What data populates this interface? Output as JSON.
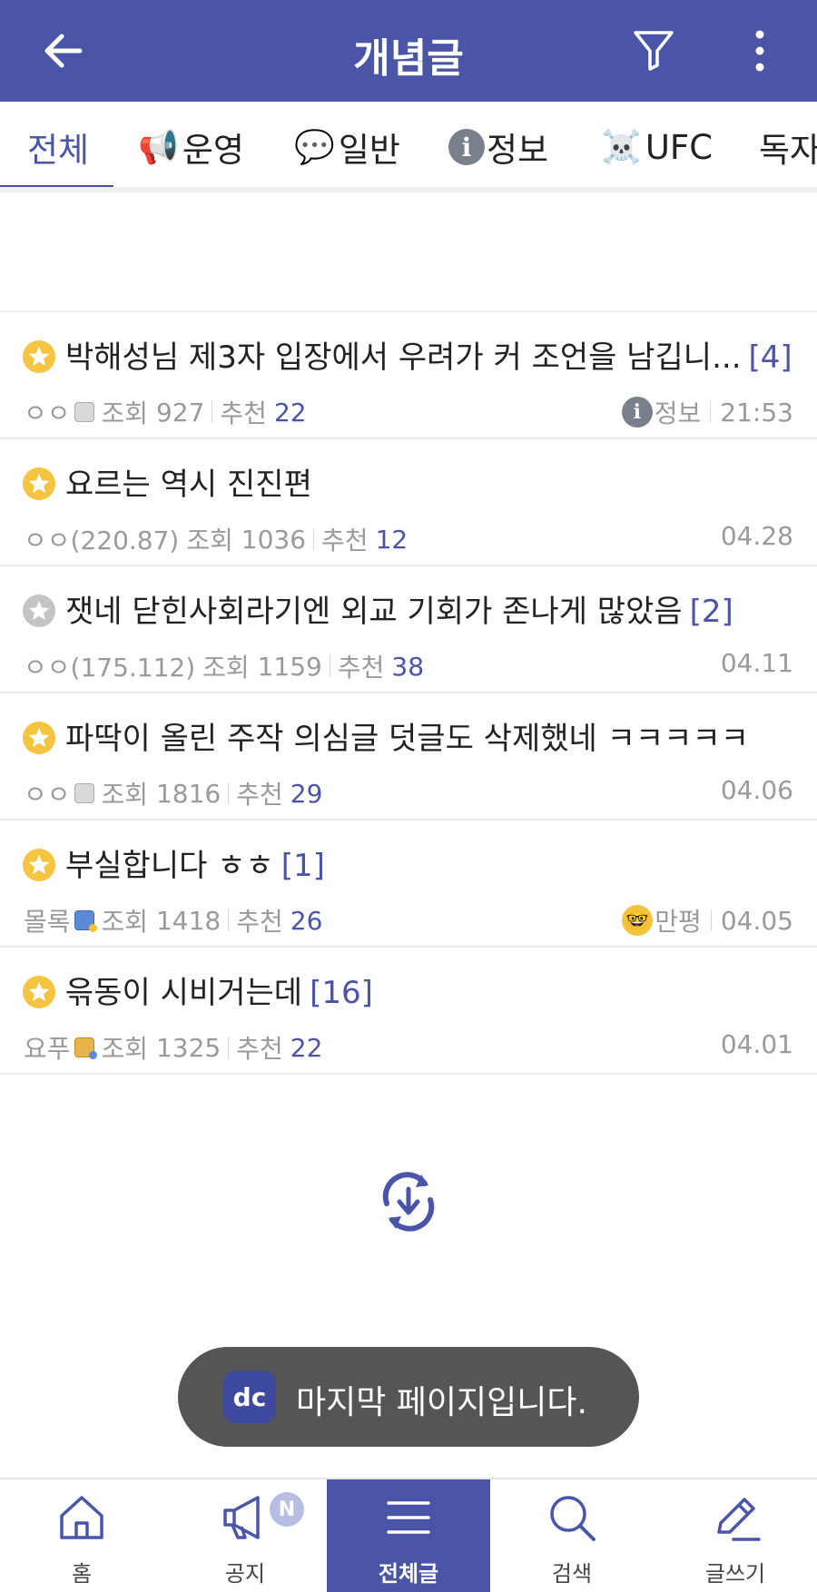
{
  "header": {
    "title": "개념글"
  },
  "tabs": [
    {
      "label": "전체",
      "icon": "",
      "active": true
    },
    {
      "label": "운영",
      "icon": "megaphone-emoji",
      "glyph": "📢"
    },
    {
      "label": "일반",
      "icon": "speech-balloon-emoji",
      "glyph": "💬"
    },
    {
      "label": "정보",
      "icon": "info-icon",
      "glyph": "i"
    },
    {
      "label": "UFC",
      "icon": "skull-crossbones-emoji",
      "glyph": "☠️"
    },
    {
      "label": "독자",
      "icon": ""
    }
  ],
  "posts": [
    {
      "title": "박해성님 제3자 입장에서 우려가 커 조언을 남깁니...",
      "comments": "[4]",
      "author": "ㅇㅇ",
      "level": "gray",
      "views_label": "조회",
      "views": "927",
      "rec_label": "추천",
      "rec": "22",
      "head": "정보",
      "head_icon": "info-icon",
      "time": "21:53",
      "star": "gold"
    },
    {
      "title": "요르는 역시 진진편",
      "comments": "",
      "author": "ㅇㅇ(220.87)",
      "level": "",
      "views_label": "조회",
      "views": "1036",
      "rec_label": "추천",
      "rec": "12",
      "head": "",
      "time": "04.28",
      "star": "gold"
    },
    {
      "title": "잿네 닫힌사회라기엔 외교 기회가 존나게 많았음",
      "comments": "[2]",
      "author": "ㅇㅇ(175.112)",
      "level": "",
      "views_label": "조회",
      "views": "1159",
      "rec_label": "추천",
      "rec": "38",
      "head": "",
      "time": "04.11",
      "star": "gray"
    },
    {
      "title": "파딱이 올린 주작 의심글 덧글도 삭제했네 ㅋㅋㅋㅋㅋ",
      "comments": "",
      "author": "ㅇㅇ",
      "level": "gray",
      "views_label": "조회",
      "views": "1816",
      "rec_label": "추천",
      "rec": "29",
      "head": "",
      "time": "04.06",
      "star": "gold"
    },
    {
      "title": "부실합니다 ㅎㅎ",
      "comments": "[1]",
      "author": "몰록",
      "level": "blue",
      "views_label": "조회",
      "views": "1418",
      "rec_label": "추천",
      "rec": "26",
      "head": "만평",
      "head_icon": "nerd-face-emoji",
      "time": "04.05",
      "star": "gold"
    },
    {
      "title": "윾동이 시비거는데",
      "comments": "[16]",
      "author": "요푸",
      "level": "gold",
      "views_label": "조회",
      "views": "1325",
      "rec_label": "추천",
      "rec": "22",
      "head": "",
      "time": "04.01",
      "star": "gold"
    }
  ],
  "toast": {
    "logo": "dc",
    "message": "마지막 페이지입니다."
  },
  "bottom_nav": [
    {
      "label": "홈",
      "icon": "home-icon"
    },
    {
      "label": "공지",
      "icon": "megaphone-icon",
      "badge": "N"
    },
    {
      "label": "전체글",
      "icon": "menu-icon",
      "active": true
    },
    {
      "label": "검색",
      "icon": "search-icon"
    },
    {
      "label": "글쓰기",
      "icon": "pen-icon"
    }
  ],
  "colors": {
    "brand": "#4a55a8",
    "star_gold": "#f5c542",
    "star_gray": "#c4c4c4",
    "meta_gray": "#9a9a9a"
  }
}
